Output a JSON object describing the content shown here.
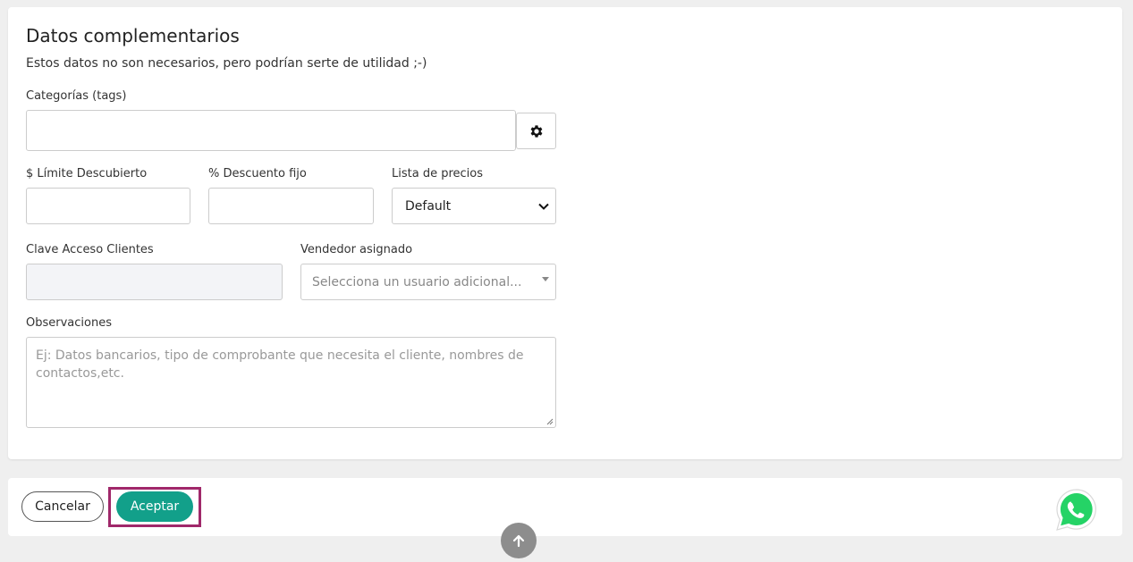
{
  "section": {
    "title": "Datos complementarios",
    "subtitle": "Estos datos no son necesarios, pero podrían serte de utilidad ;-)"
  },
  "fields": {
    "categories": {
      "label": "Categorías (tags)",
      "value": ""
    },
    "credit_limit": {
      "label": "$ Límite Descubierto",
      "value": ""
    },
    "fixed_discount": {
      "label": "% Descuento fijo",
      "value": ""
    },
    "price_list": {
      "label": "Lista de precios",
      "selected": "Default"
    },
    "client_access_key": {
      "label": "Clave Acceso Clientes",
      "value": ""
    },
    "assigned_seller": {
      "label": "Vendedor asignado",
      "placeholder": "Selecciona un usuario adicional..."
    },
    "observations": {
      "label": "Observaciones",
      "placeholder": "Ej: Datos bancarios, tipo de comprobante que necesita el cliente, nombres de contactos,etc."
    }
  },
  "footer": {
    "cancel_label": "Cancelar",
    "accept_label": "Aceptar"
  },
  "colors": {
    "accent": "#12a08a",
    "highlight": "#a0286a",
    "whatsapp": "#25d366"
  },
  "icons": [
    "gear-icon",
    "chevron-down-icon",
    "arrow-up-icon",
    "whatsapp-icon"
  ]
}
